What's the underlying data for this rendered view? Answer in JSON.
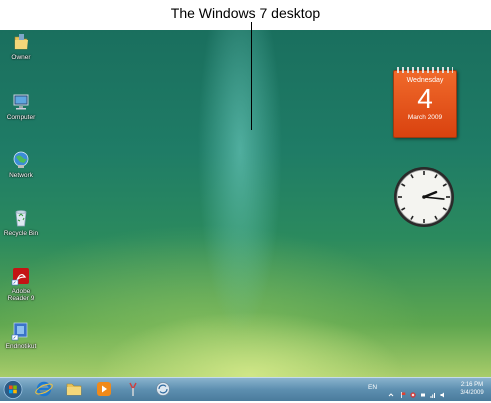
{
  "caption": "The Windows 7 desktop",
  "desktop": {
    "icons": [
      {
        "label": "Owner",
        "icon": "folder-icon"
      },
      {
        "label": "Computer",
        "icon": "computer-icon"
      },
      {
        "label": "Network",
        "icon": "network-icon"
      },
      {
        "label": "Recycle Bin",
        "icon": "recycle-bin-icon"
      },
      {
        "label": "Adobe Reader 9",
        "icon": "adobe-reader-icon"
      },
      {
        "label": "Endnotikut",
        "icon": "shortcut-icon"
      }
    ]
  },
  "gadgets": {
    "calendar": {
      "weekday": "Wednesday",
      "day": "4",
      "month_year": "March 2009"
    },
    "clock": {
      "time": "2:16"
    }
  },
  "taskbar": {
    "buttons": [
      {
        "name": "start-orb",
        "icon": "windows-logo-icon"
      },
      {
        "name": "internet-explorer",
        "icon": "ie-icon"
      },
      {
        "name": "windows-explorer",
        "icon": "folder-icon"
      },
      {
        "name": "media-player",
        "icon": "media-player-icon"
      },
      {
        "name": "app-4",
        "icon": "wand-icon"
      },
      {
        "name": "app-5",
        "icon": "sync-icon"
      }
    ],
    "tray": {
      "language": "EN",
      "time": "2:16 PM",
      "date": "3/4/2009"
    }
  },
  "colors": {
    "calendar_orange": "#e4531a",
    "taskbar_blue": "#5d8fb0",
    "desktop_green": "#1f7c66"
  }
}
